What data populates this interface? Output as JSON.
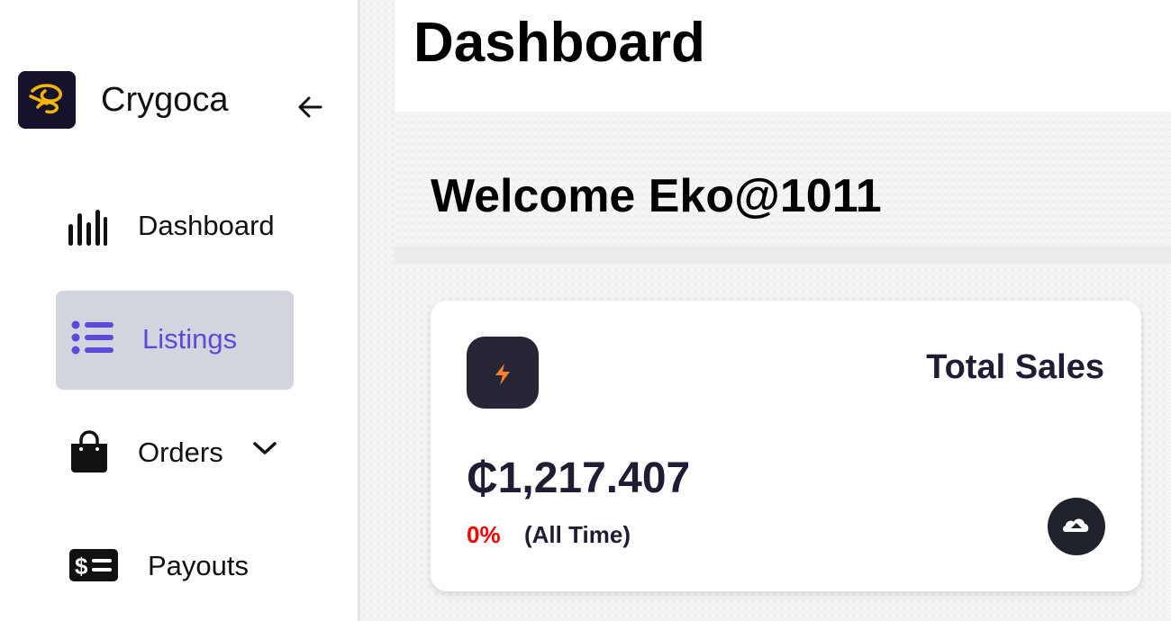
{
  "brand": {
    "name": "Crygoca",
    "logo_icon": "butterfly-logo-icon",
    "logo_bg": "#15132b",
    "logo_accent": "#f5b400"
  },
  "sidebar": {
    "collapse_icon": "arrow-left-icon",
    "active_color": "#5a4bd9",
    "active_bg": "#d3d5de",
    "items": [
      {
        "label": "Dashboard",
        "icon": "bar-chart-icon",
        "active": false
      },
      {
        "label": "Listings",
        "icon": "list-icon",
        "active": true
      },
      {
        "label": "Orders",
        "icon": "shopping-bag-icon",
        "active": false,
        "has_dropdown": true
      },
      {
        "label": "Payouts",
        "icon": "money-bill-icon",
        "active": false
      }
    ]
  },
  "header": {
    "title": "Dashboard"
  },
  "welcome": {
    "text": "Welcome Eko@1011"
  },
  "stats": {
    "total_sales": {
      "title": "Total Sales",
      "value": "₵1,217.407",
      "change": "0%",
      "period": "(All Time)",
      "icon": "lightning-bolt-icon",
      "icon_color": "#f7812b",
      "change_color": "#ff0000",
      "trend_icon": "cloud-upload-icon"
    }
  }
}
